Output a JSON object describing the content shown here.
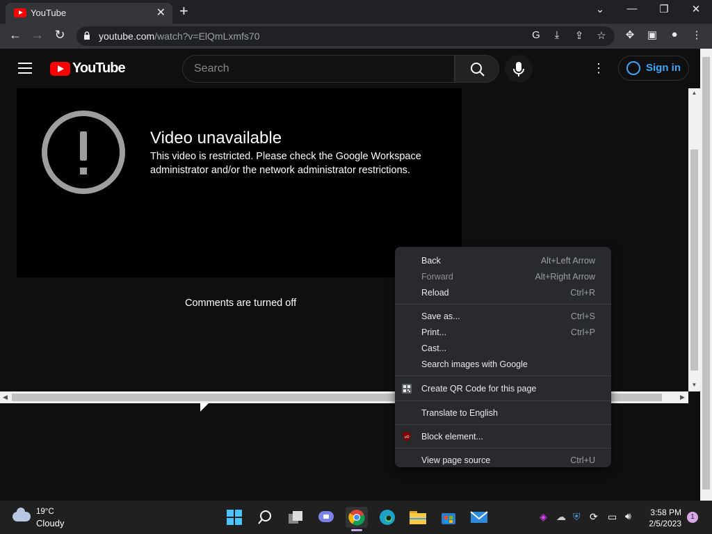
{
  "browser": {
    "tab_title": "YouTube",
    "tab_close": "✕",
    "new_tab": "+",
    "url_host": "youtube.com",
    "url_path": "/watch?v=ElQmLxmfs70",
    "window_controls": {
      "dropdown": "⌄",
      "minimize": "—",
      "restore": "❐",
      "close": "✕"
    },
    "nav": {
      "back": "←",
      "forward": "→",
      "reload": "↻"
    }
  },
  "youtube": {
    "logo_text": "YouTube",
    "search_placeholder": "Search",
    "sign_in": "Sign in",
    "player": {
      "title": "Video unavailable",
      "message": "This video is restricted. Please check the Google Workspace administrator and/or the network administrator restrictions."
    },
    "comments_status": "Comments are turned off"
  },
  "context_menu": {
    "items": [
      {
        "label": "Back",
        "shortcut": "Alt+Left Arrow",
        "disabled": false
      },
      {
        "label": "Forward",
        "shortcut": "Alt+Right Arrow",
        "disabled": true
      },
      {
        "label": "Reload",
        "shortcut": "Ctrl+R",
        "disabled": false
      },
      {
        "label": "Save as...",
        "shortcut": "Ctrl+S",
        "disabled": false
      },
      {
        "label": "Print...",
        "shortcut": "Ctrl+P",
        "disabled": false
      },
      {
        "label": "Cast...",
        "shortcut": "",
        "disabled": false
      },
      {
        "label": "Search images with Google",
        "shortcut": "",
        "disabled": false
      },
      {
        "label": "Create QR Code for this page",
        "shortcut": "",
        "disabled": false,
        "icon": "qr-code-icon"
      },
      {
        "label": "Translate to English",
        "shortcut": "",
        "disabled": false
      },
      {
        "label": "Block element...",
        "shortcut": "",
        "disabled": false,
        "icon": "ublock-origin-icon"
      },
      {
        "label": "View page source",
        "shortcut": "Ctrl+U",
        "disabled": false
      }
    ]
  },
  "taskbar": {
    "weather_temp": "19°C",
    "weather_desc": "Cloudy",
    "time": "3:58 PM",
    "date": "2/5/2023",
    "notification_count": "1",
    "apps": [
      "windows-start-icon",
      "search-icon",
      "task-view-icon",
      "teams-chat-icon",
      "chrome-icon",
      "edge-icon",
      "file-explorer-icon",
      "microsoft-store-icon",
      "mail-icon"
    ]
  },
  "colors": {
    "youtube_red": "#ff0000",
    "signin_blue": "#3ea6ff",
    "menu_bg": "#292a2d",
    "page_bg": "#0f0f0f"
  }
}
